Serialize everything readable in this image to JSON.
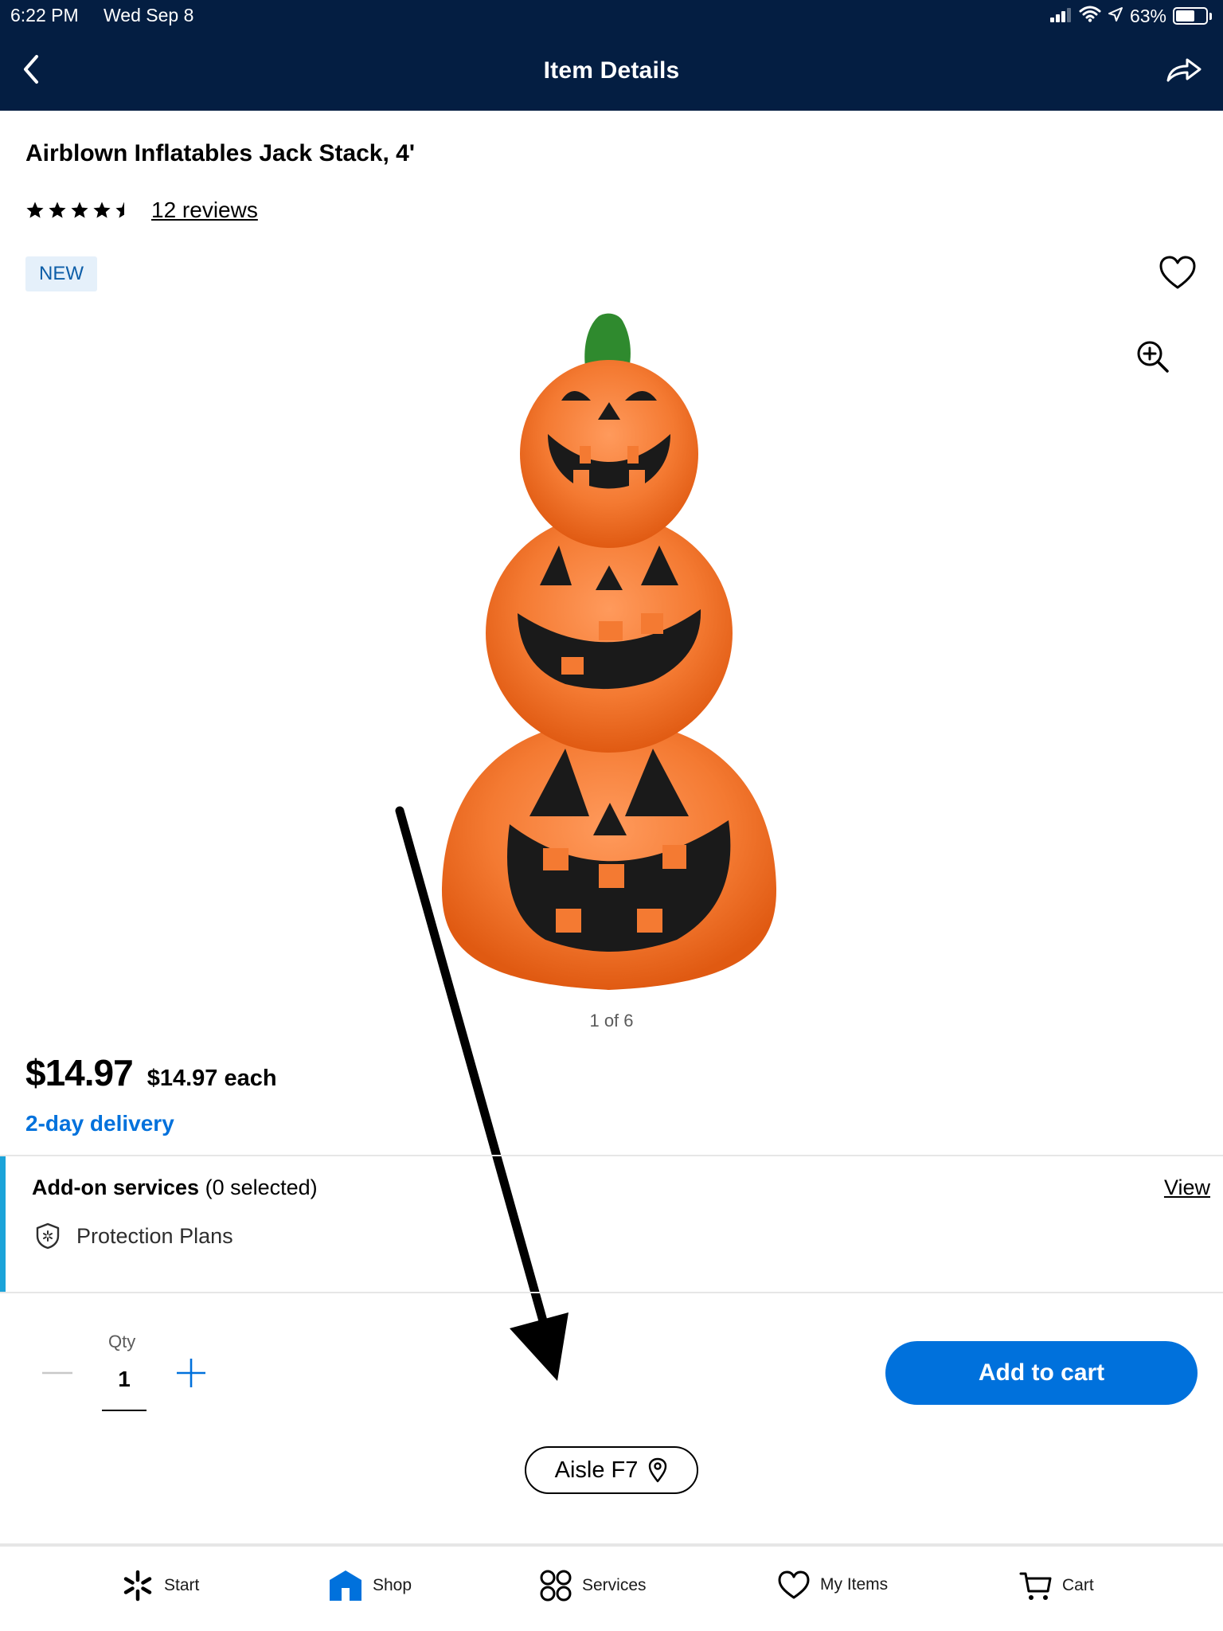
{
  "status_bar": {
    "time": "6:22 PM",
    "date": "Wed Sep 8",
    "battery": "63%",
    "battery_level": 0.63,
    "icons": [
      "signal-icon",
      "wifi-icon",
      "location-icon",
      "battery-icon"
    ]
  },
  "nav": {
    "title": "Item Details",
    "back_icon": "chevron-left-icon",
    "share_icon": "share-icon"
  },
  "product": {
    "title": "Airblown Inflatables Jack Stack, 4'",
    "rating": 4.5,
    "rating_max": 5,
    "reviews": "12 reviews",
    "badge": "NEW",
    "image_counter": "1 of 6",
    "price": "$14.97",
    "unit_price": "$14.97 each",
    "delivery": "2-day delivery"
  },
  "addons": {
    "title": "Add-on services",
    "selected": "(0 selected)",
    "view": "View",
    "items": [
      "Protection Plans"
    ]
  },
  "purchase": {
    "qty_label": "Qty",
    "qty": "1",
    "add_to_cart": "Add to cart",
    "aisle": "Aisle F7"
  },
  "tabs": [
    {
      "label": "Start",
      "icon": "spark-icon"
    },
    {
      "label": "Shop",
      "icon": "store-icon"
    },
    {
      "label": "Services",
      "icon": "services-icon"
    },
    {
      "label": "My Items",
      "icon": "heart-icon"
    },
    {
      "label": "Cart",
      "icon": "cart-icon"
    }
  ],
  "colors": {
    "header": "#041e42",
    "accent": "#0071dc",
    "addon_accent": "#1ba3d9",
    "badge_bg": "#e5f0fa",
    "badge_text": "#0d5ea8",
    "pumpkin": "#f26b1d",
    "stem": "#2f8a2e"
  }
}
